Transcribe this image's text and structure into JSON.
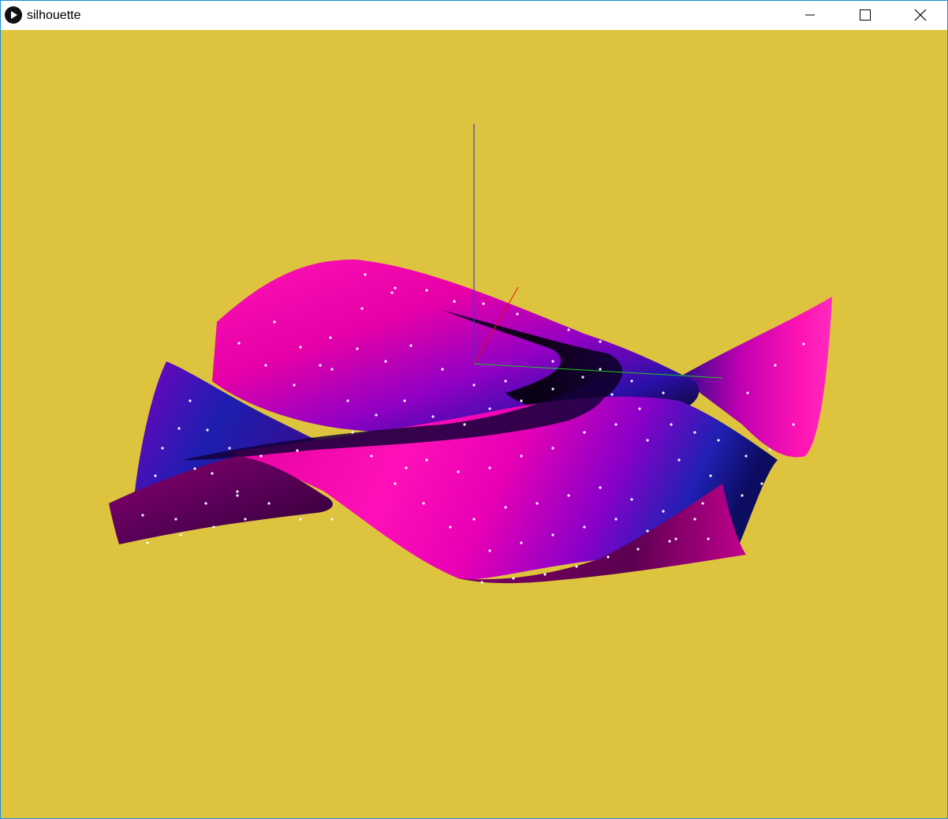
{
  "window": {
    "title": "silhouette",
    "controls": {
      "minimize": "minimize-icon",
      "maximize": "maximize-icon",
      "close": "close-icon"
    }
  },
  "scene": {
    "background_color": "#dec43e",
    "axes": {
      "x_color": "#e01515",
      "y_color": "#23c423",
      "z_color": "#3d3dcc"
    },
    "surface_colors": {
      "highlight": "#ff10b8",
      "mid": "#9a00c8",
      "deep": "#1a1aa6",
      "shadow": "#000000"
    }
  }
}
